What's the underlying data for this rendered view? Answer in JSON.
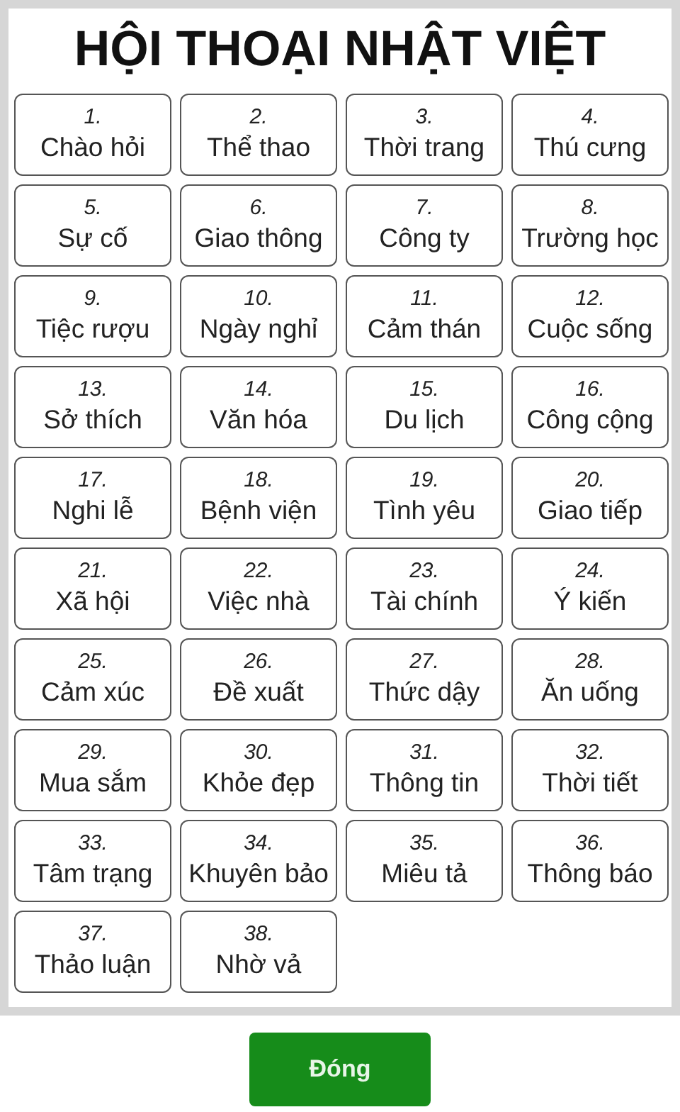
{
  "title": "HỘI THOẠI NHẬT VIỆT",
  "topics": [
    {
      "number": "1.",
      "label": "Chào hỏi"
    },
    {
      "number": "2.",
      "label": "Thể thao"
    },
    {
      "number": "3.",
      "label": "Thời trang"
    },
    {
      "number": "4.",
      "label": "Thú cưng"
    },
    {
      "number": "5.",
      "label": "Sự cố"
    },
    {
      "number": "6.",
      "label": "Giao thông"
    },
    {
      "number": "7.",
      "label": "Công ty"
    },
    {
      "number": "8.",
      "label": "Trường học"
    },
    {
      "number": "9.",
      "label": "Tiệc rượu"
    },
    {
      "number": "10.",
      "label": "Ngày nghỉ"
    },
    {
      "number": "11.",
      "label": "Cảm thán"
    },
    {
      "number": "12.",
      "label": "Cuộc sống"
    },
    {
      "number": "13.",
      "label": "Sở thích"
    },
    {
      "number": "14.",
      "label": "Văn hóa"
    },
    {
      "number": "15.",
      "label": "Du lịch"
    },
    {
      "number": "16.",
      "label": "Công cộng"
    },
    {
      "number": "17.",
      "label": "Nghi lễ"
    },
    {
      "number": "18.",
      "label": "Bệnh viện"
    },
    {
      "number": "19.",
      "label": "Tình yêu"
    },
    {
      "number": "20.",
      "label": "Giao tiếp"
    },
    {
      "number": "21.",
      "label": "Xã hội"
    },
    {
      "number": "22.",
      "label": "Việc nhà"
    },
    {
      "number": "23.",
      "label": "Tài chính"
    },
    {
      "number": "24.",
      "label": "Ý kiến"
    },
    {
      "number": "25.",
      "label": "Cảm xúc"
    },
    {
      "number": "26.",
      "label": "Đề xuất"
    },
    {
      "number": "27.",
      "label": "Thức dậy"
    },
    {
      "number": "28.",
      "label": "Ăn uống"
    },
    {
      "number": "29.",
      "label": "Mua sắm"
    },
    {
      "number": "30.",
      "label": "Khỏe đẹp"
    },
    {
      "number": "31.",
      "label": "Thông tin"
    },
    {
      "number": "32.",
      "label": "Thời tiết"
    },
    {
      "number": "33.",
      "label": "Tâm trạng"
    },
    {
      "number": "34.",
      "label": "Khuyên bảo"
    },
    {
      "number": "35.",
      "label": "Miêu tả"
    },
    {
      "number": "36.",
      "label": "Thông báo"
    },
    {
      "number": "37.",
      "label": "Thảo luận"
    },
    {
      "number": "38.",
      "label": "Nhờ vả"
    }
  ],
  "close_button": "Đóng"
}
